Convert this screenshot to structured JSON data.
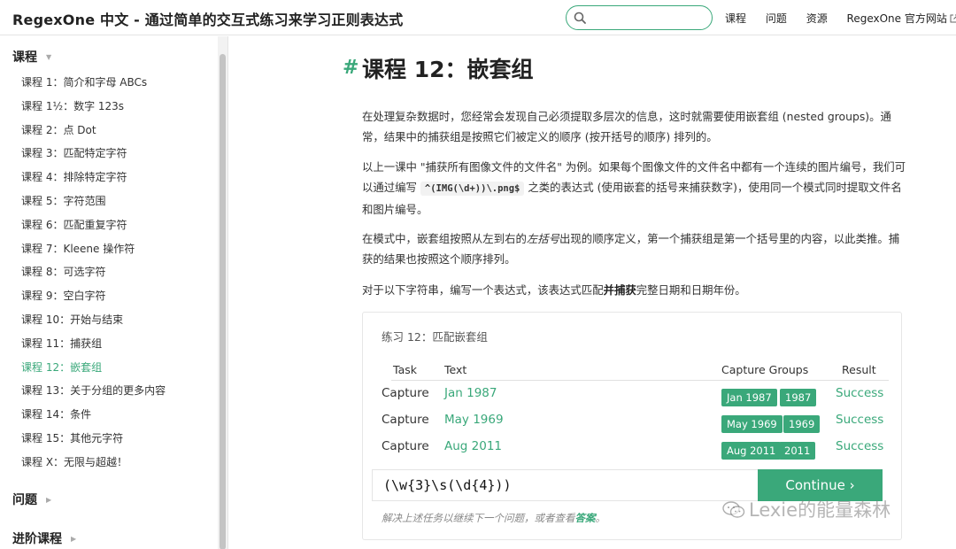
{
  "header": {
    "title": "RegexOne 中文 - 通过简单的交互式练习来学习正则表达式",
    "search": {
      "value": "",
      "placeholder": ""
    },
    "nav": [
      "课程",
      "问题",
      "资源",
      "RegexOne 官方网站"
    ]
  },
  "sidebar": {
    "sections": [
      {
        "title": "课程",
        "expanded": true
      },
      {
        "title": "问题",
        "expanded": false
      },
      {
        "title": "进阶课程",
        "expanded": false
      }
    ],
    "lessons": [
      "课程 1：简介和字母 ABCs",
      "课程 1½：数字 123s",
      "课程 2：点 Dot",
      "课程 3：匹配特定字符",
      "课程 4：排除特定字符",
      "课程 5：字符范围",
      "课程 6：匹配重复字符",
      "课程 7：Kleene 操作符",
      "课程 8：可选字符",
      "课程 9：空白字符",
      "课程 10：开始与结束",
      "课程 11：捕获组",
      "课程 12：嵌套组",
      "课程 13：关于分组的更多内容",
      "课程 14：条件",
      "课程 15：其他元字符",
      "课程 X：无限与超越！"
    ],
    "active_index": 12
  },
  "main": {
    "hash": "#",
    "title": "课程 12：嵌套组",
    "p1": "在处理复杂数据时，您经常会发现自己必须提取多层次的信息，这时就需要使用嵌套组 (nested groups)。通常，结果中的捕获组是按照它们被定义的顺序 (按开括号的顺序) 排列的。",
    "p2_a": "以上一课中 \"捕获所有图像文件的文件名\" 为例。如果每个图像文件的文件名中都有一个连续的图片编号，我们可以通过编写 ",
    "p2_code": "^(IMG(\\d+))\\.png$",
    "p2_b": " 之类的表达式 (使用嵌套的括号来捕获数字)，使用同一个模式同时提取文件名和图片编号。",
    "p3_a": "在模式中，嵌套组按照从左到右的",
    "p3_em": "左括号",
    "p3_b": "出现的顺序定义，第一个捕获组是第一个括号里的内容，以此类推。捕获的结果也按照这个顺序排列。",
    "p4_a": "对于以下字符串，编写一个表达式，该表达式匹配",
    "p4_strong": "并捕获",
    "p4_b": "完整日期和日期年份。"
  },
  "exercise": {
    "title": "练习 12：匹配嵌套组",
    "headers": {
      "task": "Task",
      "text": "Text",
      "groups": "Capture Groups",
      "result": "Result"
    },
    "rows": [
      {
        "task": "Capture",
        "text": "Jan 1987",
        "groups": [
          "Jan 1987",
          "1987"
        ],
        "result": "Success"
      },
      {
        "task": "Capture",
        "text": "May 1969",
        "groups": [
          "May 1969",
          "1969"
        ],
        "result": "Success"
      },
      {
        "task": "Capture",
        "text": "Aug 2011",
        "groups": [
          "Aug 2011",
          "2011"
        ],
        "result": "Success"
      }
    ],
    "input_value": "(\\w{3}\\s(\\d{4}))",
    "continue_label": "Continue ›",
    "hint_a": "解决上述任务以继续下一个问题，或者查看",
    "hint_link": "答案",
    "hint_b": "。"
  },
  "watermark": {
    "text": "Lexie的能量森林"
  },
  "colors": {
    "accent": "#3aa87a",
    "text": "#333333",
    "border": "#e4e4e4"
  },
  "icons": [
    "search-icon",
    "external-link-icon",
    "caret-down-icon",
    "caret-right-icon",
    "wechat-icon"
  ]
}
